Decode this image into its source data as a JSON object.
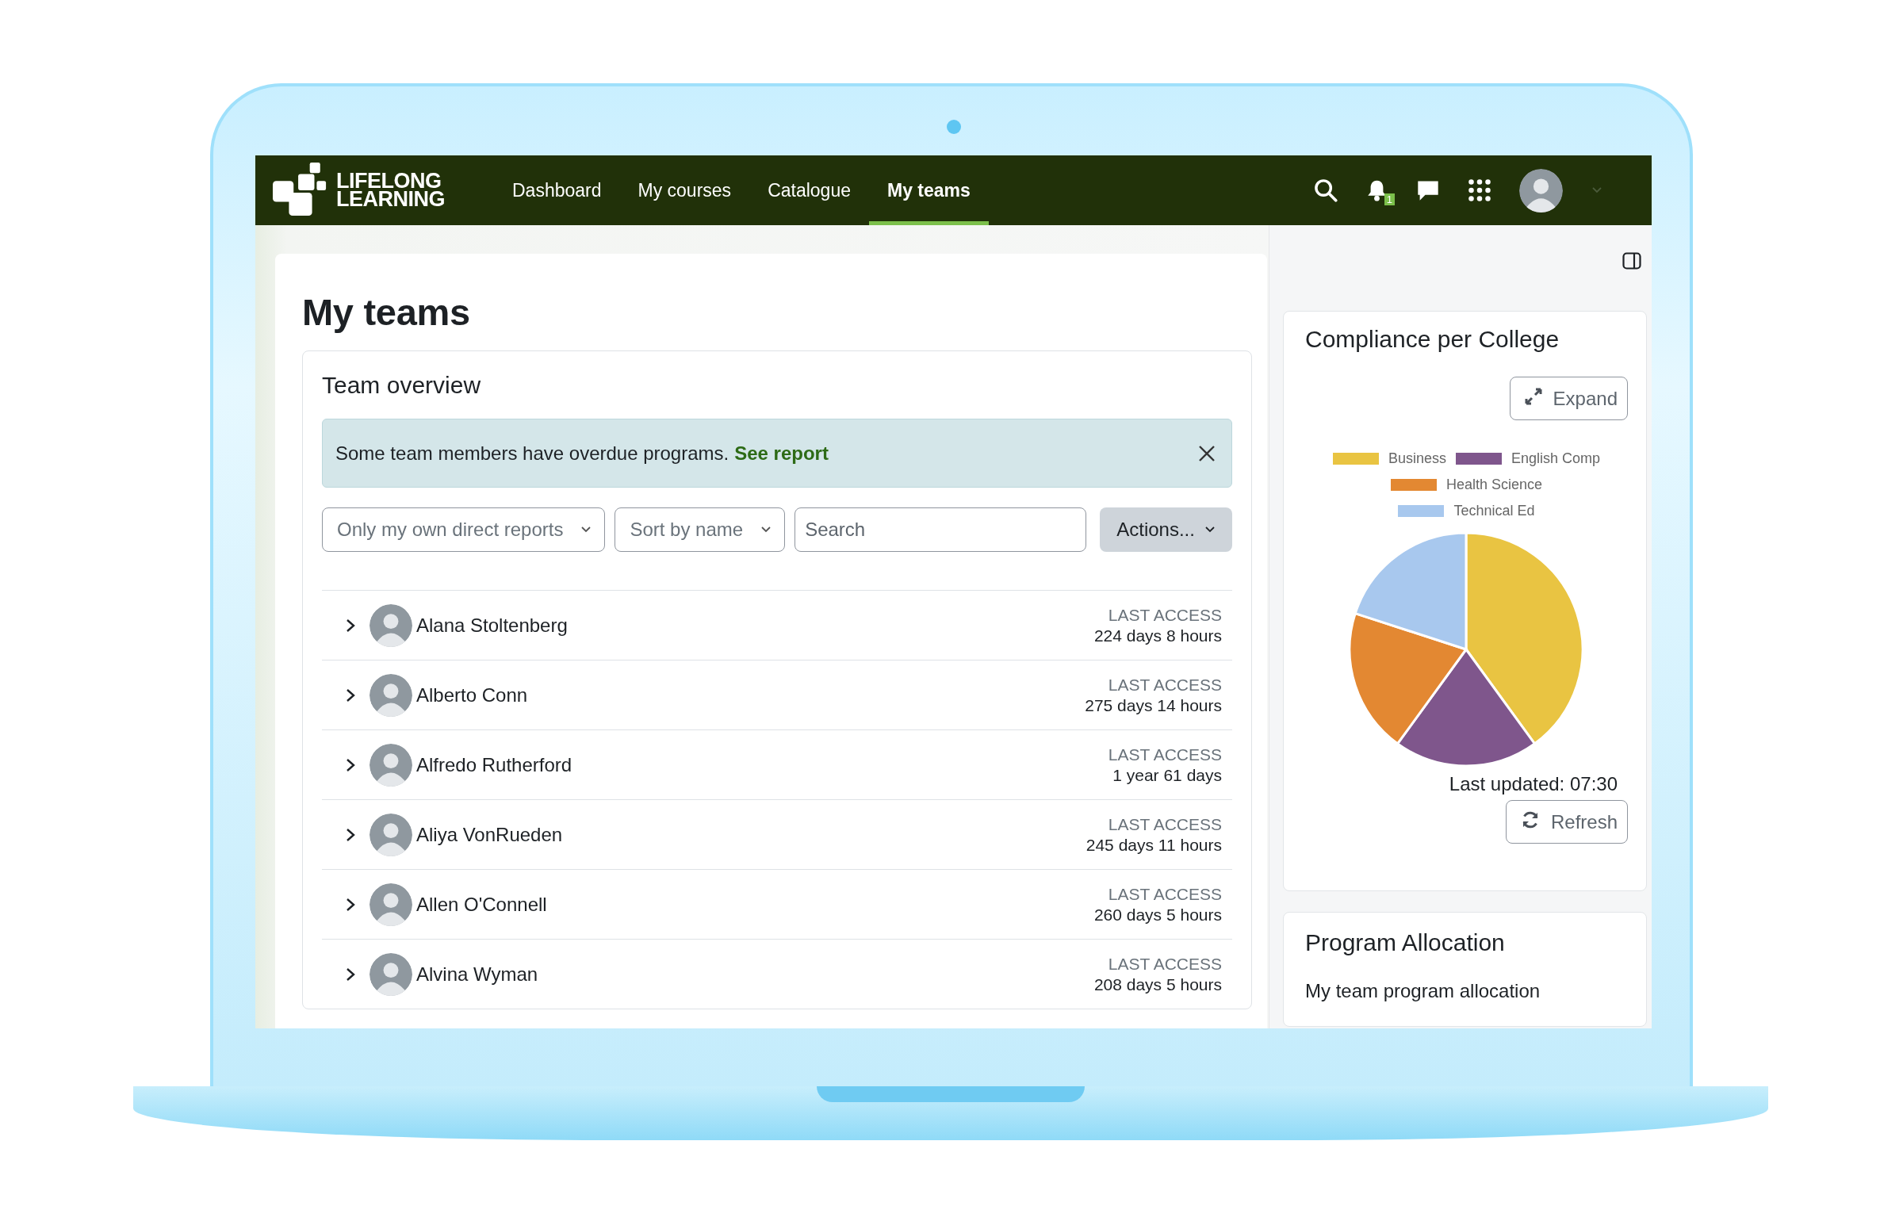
{
  "brand": {
    "lines": [
      "LIFELONG",
      "LEARNING"
    ]
  },
  "nav": {
    "items": [
      {
        "label": "Dashboard",
        "selected": false
      },
      {
        "label": "My courses",
        "selected": false
      },
      {
        "label": "Catalogue",
        "selected": false
      },
      {
        "label": "My teams",
        "selected": true
      }
    ],
    "notification_count": "1"
  },
  "page_title": "My teams",
  "team_overview": {
    "title": "Team overview",
    "alert": {
      "message": "Some team members have overdue programs.",
      "link": "See report"
    },
    "filters": [
      {
        "kind": "select",
        "label": "Only my own direct reports"
      },
      {
        "kind": "select",
        "label": "Sort by name"
      },
      {
        "kind": "search",
        "placeholder": "Search"
      },
      {
        "kind": "menu",
        "label": "Actions..."
      }
    ],
    "members": [
      {
        "name": "Alana Stoltenberg",
        "last_access_label": "LAST ACCESS",
        "last_access": "224 days 8 hours",
        "expanded": false
      },
      {
        "name": "Alberto Conn",
        "last_access_label": "LAST ACCESS",
        "last_access": "275 days 14 hours",
        "expanded": false
      },
      {
        "name": "Alfredo Rutherford",
        "last_access_label": "LAST ACCESS",
        "last_access": "1 year 61 days",
        "expanded": false
      },
      {
        "name": "Aliya VonRueden",
        "last_access_label": "LAST ACCESS",
        "last_access": "245 days 11 hours",
        "expanded": false
      },
      {
        "name": "Allen O'Connell",
        "last_access_label": "LAST ACCESS",
        "last_access": "260 days 5 hours",
        "expanded": false
      },
      {
        "name": "Alvina Wyman",
        "last_access_label": "LAST ACCESS",
        "last_access": "208 days 5 hours",
        "expanded": false
      }
    ]
  },
  "compliance_card": {
    "title": "Compliance per College",
    "expand_button": "Expand",
    "chart_data": {
      "type": "pie",
      "categories": [
        "Business",
        "English Comp",
        "Health Science",
        "Technical Ed"
      ],
      "values": [
        40,
        20,
        20,
        20
      ],
      "colors": [
        "#e9c442",
        "#7f568c",
        "#e38832",
        "#a8c8ee"
      ]
    },
    "last_updated": "Last updated: 07:30",
    "refresh_button": "Refresh"
  },
  "program_card": {
    "title": "Program Allocation",
    "subtitle": "My team program allocation"
  }
}
